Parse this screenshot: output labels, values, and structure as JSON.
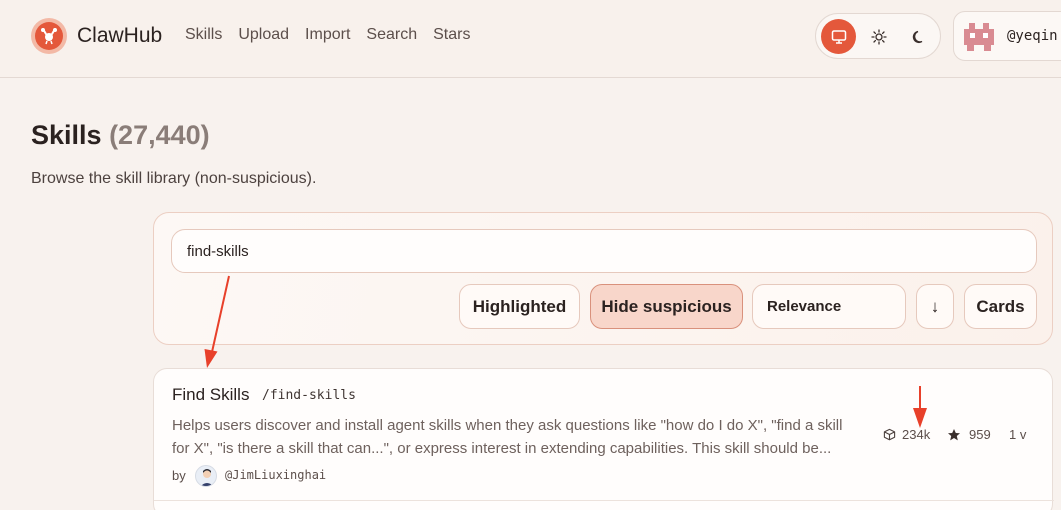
{
  "header": {
    "brand": "ClawHub",
    "nav": [
      "Skills",
      "Upload",
      "Import",
      "Search",
      "Stars"
    ],
    "user": "@yeqin"
  },
  "page": {
    "title": "Skills",
    "count": "(27,440)",
    "subtitle": "Browse the skill library (non-suspicious)."
  },
  "search": {
    "value": "find-skills",
    "highlighted_label": "Highlighted",
    "hide_suspicious_label": "Hide suspicious",
    "sort_label": "Relevance",
    "direction_label": "↓",
    "view_label": "Cards"
  },
  "results": [
    {
      "title": "Find Skills",
      "slug": "/find-skills",
      "description": "Helps users discover and install agent skills when they ask questions like \"how do I do X\", \"find a skill for X\", \"is there a skill that can...\", or express interest in extending capabilities. This skill should be...",
      "by": "by",
      "author": "@JimLiuxinghai",
      "downloads": "234k",
      "stars": "959",
      "versions": "1 v"
    }
  ],
  "colors": {
    "accent": "#e4583b",
    "annotation": "#e8402a",
    "background": "#f8f2ee"
  }
}
